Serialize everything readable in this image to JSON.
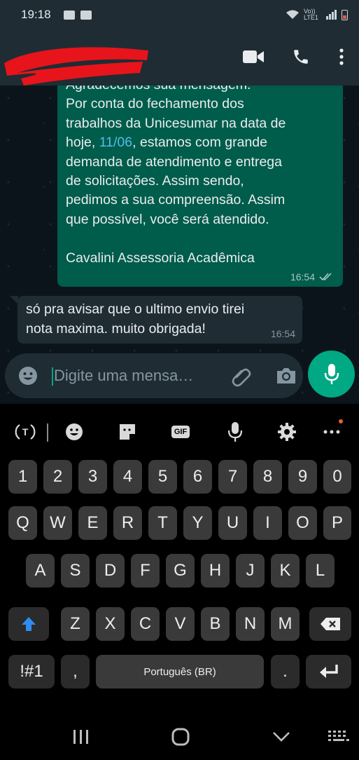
{
  "status_bar": {
    "time": "19:18",
    "network": "Vo)) LTE1"
  },
  "header": {
    "contact_name": "[redacted]"
  },
  "messages": {
    "outgoing": {
      "line_partial": "Agradecemos sua mensagem.",
      "lines_before_link": "Por conta do fechamento dos\ntrabalhos da Unicesumar na data de\nhoje, ",
      "link": "11/06",
      "lines_after_link": ", estamos com grande\ndemanda de atendimento e entrega\nde solicitações. Assim sendo,\npedimos a sua compreensão. Assim\nque possível, você será atendido.\n\nCavalini Assessoria Acadêmica",
      "time": "16:54"
    },
    "incoming": {
      "text": "só pra avisar que o ultimo envio tirei\nnota maxima. muito obrigada!",
      "time": "16:54"
    }
  },
  "composer": {
    "placeholder": "Digite uma mensa…"
  },
  "keyboard": {
    "row_numbers": [
      "1",
      "2",
      "3",
      "4",
      "5",
      "6",
      "7",
      "8",
      "9",
      "0"
    ],
    "row_q": [
      "Q",
      "W",
      "E",
      "R",
      "T",
      "Y",
      "U",
      "I",
      "O",
      "P"
    ],
    "row_a": [
      "A",
      "S",
      "D",
      "F",
      "G",
      "H",
      "J",
      "K",
      "L"
    ],
    "row_z": [
      "Z",
      "X",
      "C",
      "V",
      "B",
      "N",
      "M"
    ],
    "symbols_key": "!#1",
    "comma_key": ",",
    "space_label": "Português (BR)",
    "period_key": ".",
    "gif_label": "GIF"
  },
  "colors": {
    "accent": "#00a884",
    "outgoing_bubble": "#005c4b",
    "incoming_bubble": "#1f2c34",
    "link": "#53bdeb",
    "redaction": "#e8141b"
  }
}
